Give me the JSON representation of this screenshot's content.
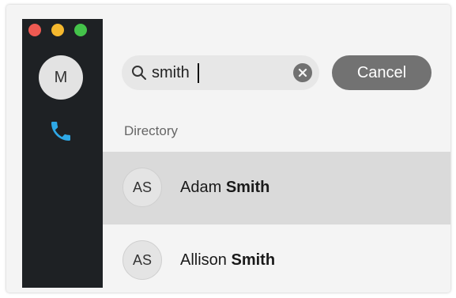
{
  "sidebar": {
    "traffic_lights": [
      "close",
      "minimize",
      "zoom"
    ],
    "colors": {
      "background": "#1e2124",
      "red": "#ee5a52",
      "yellow": "#f5b82e",
      "green": "#44c34a",
      "phone": "#2ea8e6"
    },
    "user_avatar_initial": "M",
    "nav_icon": "phone-icon"
  },
  "search": {
    "value": "smith",
    "icon": "search-icon",
    "clear_icon": "clear-icon"
  },
  "cancel_label": "Cancel",
  "section_label": "Directory",
  "results": [
    {
      "initials": "AS",
      "first": "Adam",
      "last": "Smith",
      "selected": true
    },
    {
      "initials": "AS",
      "first": "Allison",
      "last": "Smith",
      "selected": false
    }
  ]
}
